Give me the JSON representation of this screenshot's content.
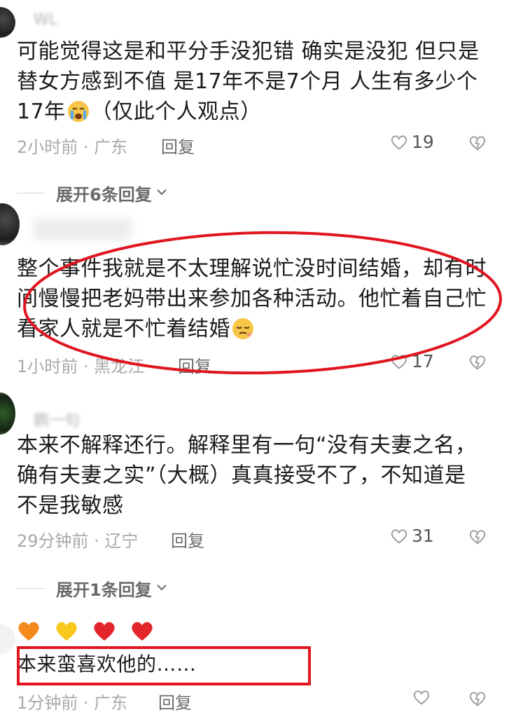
{
  "comments": [
    {
      "username": "WL",
      "text_line1": "可能觉得这是和平分手没犯错 确实是没犯 但只是",
      "text_line2": "替女方感到不值 是17年不是7个月 人生有多少个",
      "text_line3a": "17年",
      "text_line3b": "（仅此个人观点）",
      "emoji": "crying-face",
      "time_location": "2小时前 · 广东",
      "reply_label": "回复",
      "likes": "19",
      "expand_label": "展开6条回复"
    },
    {
      "username": "",
      "text_line1": "整个事件我就是不太理解说忙没时间结婚，却有时",
      "text_line2": "间慢慢把老妈带出来参加各种活动。他忙着自己忙",
      "text_line3a": "看家人就是不忙着结婚",
      "emoji": "pensive-face",
      "time_location": "1小时前 · 黑龙江",
      "reply_label": "回复",
      "likes": "17"
    },
    {
      "username": "鹏一句",
      "text_line1": "本来不解释还行。解释里有一句“没有夫妻之名，",
      "text_line2": "确有夫妻之实”（大概）真真接受不了，不知道是",
      "text_line3a": "不是我敏感",
      "time_location": "29分钟前 · 辽宁",
      "reply_label": "回复",
      "likes": "31",
      "expand_label": "展开1条回复"
    },
    {
      "hearts": [
        "orange-heart",
        "yellow-heart",
        "red-heart",
        "red-heart"
      ],
      "text": "本来蛮喜欢他的……",
      "time_location": "1分钟前 · 广东",
      "reply_label": "回复",
      "likes": ""
    }
  ],
  "colors": {
    "annotation_red": "#e0151f",
    "meta_gray": "#a9a9a9",
    "text": "#1b1b1b"
  }
}
